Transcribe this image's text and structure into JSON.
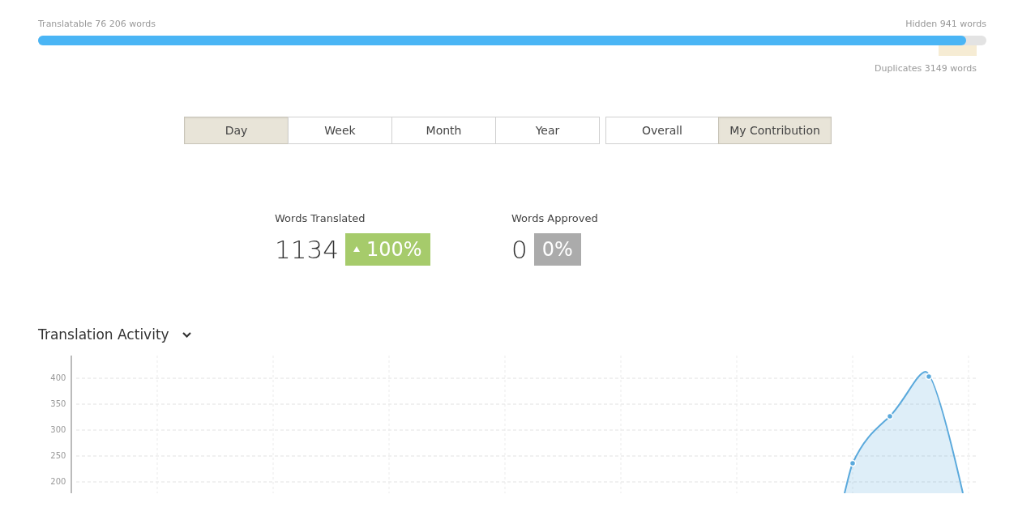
{
  "progress": {
    "translatable_label": "Translatable 76 206 words",
    "hidden_label": "Hidden 941 words",
    "level": 0.979,
    "duplicates_label": "Duplicates 3149 words"
  },
  "period_tabs": [
    {
      "label": "Day",
      "selected": true
    },
    {
      "label": "Week",
      "selected": false
    },
    {
      "label": "Month",
      "selected": false
    },
    {
      "label": "Year",
      "selected": false
    }
  ],
  "scope_tabs": [
    {
      "label": "Overall",
      "selected": false
    },
    {
      "label": "My Contribution",
      "selected": true
    }
  ],
  "stats": [
    {
      "label": "Words Translated",
      "value": "1134",
      "change": "100%",
      "kind": "increase"
    },
    {
      "label": "Words Approved",
      "value": "0",
      "change": "0%",
      "kind": "neutral"
    }
  ],
  "activity": {
    "title": "Translation Activity",
    "y_axis_labels": [
      "400",
      "350",
      "300",
      "250",
      "200"
    ]
  }
}
